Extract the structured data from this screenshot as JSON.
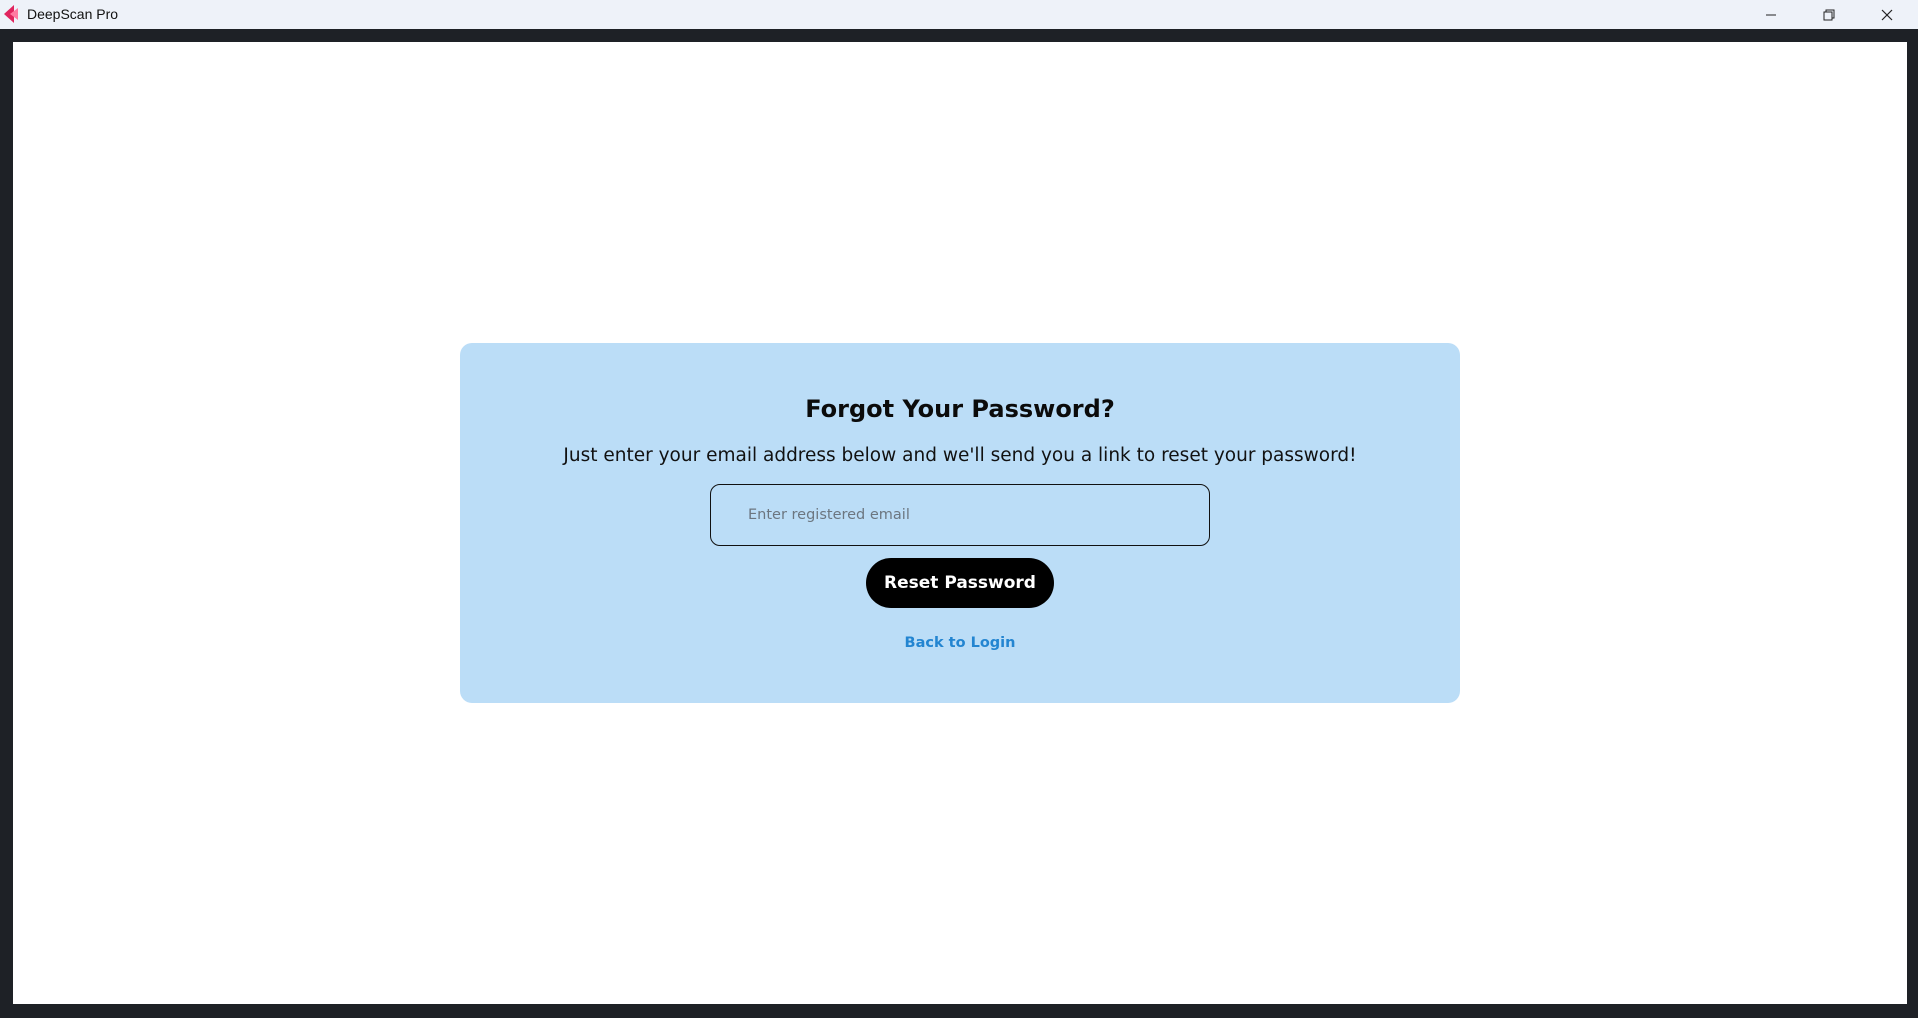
{
  "window": {
    "title": "DeepScan Pro",
    "icon": "deepscan-logo-icon",
    "controls": {
      "minimize_icon": "minimize-icon",
      "maximize_icon": "restore-icon",
      "close_icon": "close-icon"
    }
  },
  "forgot_password": {
    "title": "Forgot Your Password?",
    "subtitle": "Just enter your email address below and we'll send you a link to reset your password!",
    "email_input": {
      "placeholder": "Enter registered email",
      "value": ""
    },
    "reset_button_label": "Reset Password",
    "back_link_label": "Back to Login"
  },
  "colors": {
    "card_background": "#bbddf7",
    "button_background": "#000000",
    "link_color": "#2385d1",
    "logo_primary": "#e0245e",
    "logo_secondary": "#ff5a8a"
  }
}
